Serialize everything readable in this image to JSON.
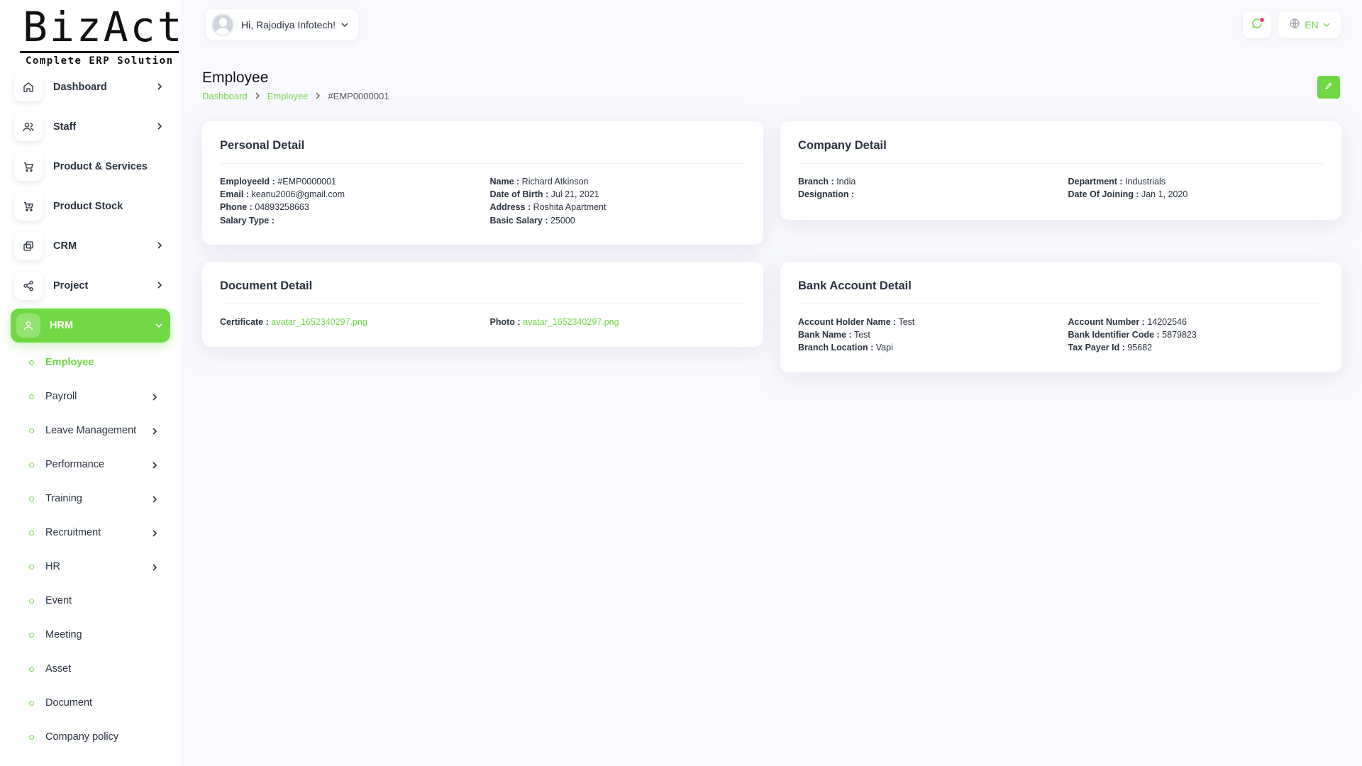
{
  "brand": {
    "name": "BizAct",
    "tagline": "Complete ERP Solution"
  },
  "header": {
    "greeting": "Hi, Rajodiya Infotech!",
    "language": "EN"
  },
  "sidebar": {
    "items": [
      {
        "label": "Dashboard",
        "icon": "home-icon",
        "has_children": true
      },
      {
        "label": "Staff",
        "icon": "users-icon",
        "has_children": true
      },
      {
        "label": "Product & Services",
        "icon": "cart-icon",
        "has_children": false
      },
      {
        "label": "Product Stock",
        "icon": "cart-plus-icon",
        "has_children": false
      },
      {
        "label": "CRM",
        "icon": "layers-icon",
        "has_children": true
      },
      {
        "label": "Project",
        "icon": "share-icon",
        "has_children": true
      },
      {
        "label": "HRM",
        "icon": "user-icon",
        "has_children": true,
        "active": true
      }
    ],
    "hrm_sub": [
      {
        "label": "Employee",
        "current": true
      },
      {
        "label": "Payroll",
        "has_children": true
      },
      {
        "label": "Leave Management",
        "has_children": true
      },
      {
        "label": "Performance",
        "has_children": true
      },
      {
        "label": "Training",
        "has_children": true
      },
      {
        "label": "Recruitment",
        "has_children": true
      },
      {
        "label": "HR",
        "has_children": true
      },
      {
        "label": "Event"
      },
      {
        "label": "Meeting"
      },
      {
        "label": "Asset"
      },
      {
        "label": "Document"
      },
      {
        "label": "Company policy"
      }
    ]
  },
  "page": {
    "title": "Employee",
    "breadcrumb": [
      "Dashboard",
      "Employee",
      "#EMP0000001"
    ]
  },
  "personal": {
    "title": "Personal Detail",
    "left": [
      {
        "k": "EmployeeId :",
        "v": "#EMP0000001"
      },
      {
        "k": "Email :",
        "v": "keanu2006@gmail.com"
      },
      {
        "k": "Phone :",
        "v": "04893258663"
      },
      {
        "k": "Salary Type :",
        "v": ""
      }
    ],
    "right": [
      {
        "k": "Name :",
        "v": "Richard Atkinson"
      },
      {
        "k": "Date of Birth :",
        "v": "Jul 21, 2021"
      },
      {
        "k": "Address :",
        "v": "Roshita Apartment"
      },
      {
        "k": "Basic Salary :",
        "v": "25000"
      }
    ]
  },
  "company": {
    "title": "Company Detail",
    "left": [
      {
        "k": "Branch :",
        "v": "India"
      },
      {
        "k": "Designation :",
        "v": ""
      }
    ],
    "right": [
      {
        "k": "Department :",
        "v": "Industrials"
      },
      {
        "k": "Date Of Joining :",
        "v": "Jan 1, 2020"
      }
    ]
  },
  "document": {
    "title": "Document Detail",
    "left": [
      {
        "k": "Certificate :",
        "v": "avatar_1652340297.png"
      }
    ],
    "right": [
      {
        "k": "Photo :",
        "v": "avatar_1652340297.png"
      }
    ]
  },
  "bank": {
    "title": "Bank Account Detail",
    "left": [
      {
        "k": "Account Holder Name :",
        "v": "Test"
      },
      {
        "k": "Bank Name :",
        "v": "Test"
      },
      {
        "k": "Branch Location :",
        "v": "Vapi"
      }
    ],
    "right": [
      {
        "k": "Account Number :",
        "v": "14202546"
      },
      {
        "k": "Bank Identifier Code :",
        "v": "5879823"
      },
      {
        "k": "Tax Payer Id :",
        "v": "95682"
      }
    ]
  },
  "colors": {
    "accent": "#6fd943",
    "text": "#293240",
    "background": "#f8f9fd"
  }
}
